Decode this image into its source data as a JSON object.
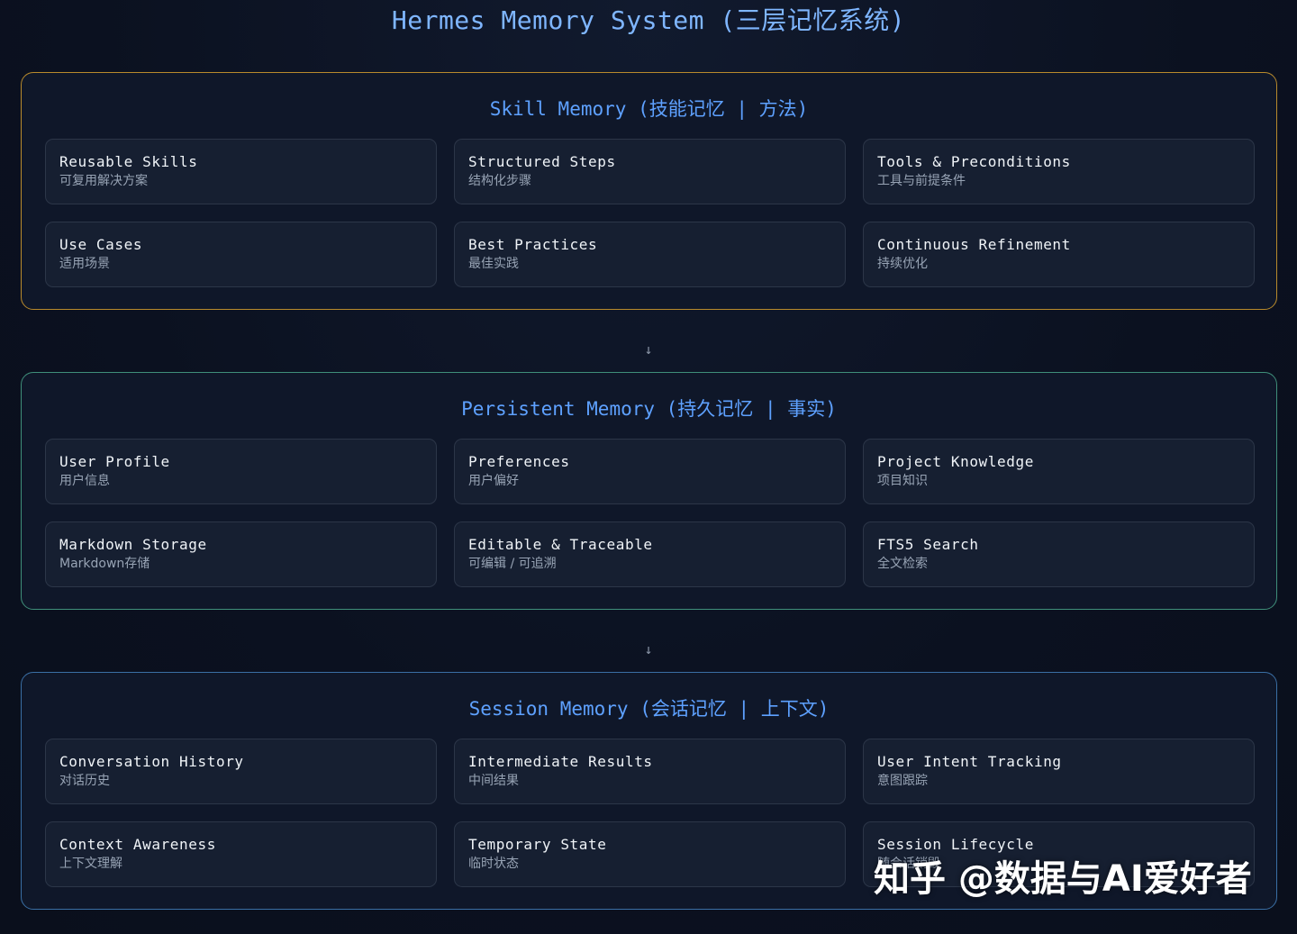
{
  "title": "Hermes Memory System (三层记忆系统)",
  "arrow": "↓",
  "watermark": "知乎 @数据与AI爱好者",
  "colors": {
    "title": "#7fb6ff",
    "skill_border": "#b88a2c",
    "persistent_border": "#3f8f7a",
    "session_border": "#3a6fa5",
    "panel_title": "#5ea1ff"
  },
  "layers": [
    {
      "title": "Skill Memory (技能记忆 | 方法)",
      "cards": [
        {
          "title": "Reusable Skills",
          "sub": "可复用解决方案"
        },
        {
          "title": "Structured Steps",
          "sub": "结构化步骤"
        },
        {
          "title": "Tools & Preconditions",
          "sub": "工具与前提条件"
        },
        {
          "title": "Use Cases",
          "sub": "适用场景"
        },
        {
          "title": "Best Practices",
          "sub": "最佳实践"
        },
        {
          "title": "Continuous Refinement",
          "sub": "持续优化"
        }
      ]
    },
    {
      "title": "Persistent Memory (持久记忆 | 事实)",
      "cards": [
        {
          "title": "User Profile",
          "sub": "用户信息"
        },
        {
          "title": "Preferences",
          "sub": "用户偏好"
        },
        {
          "title": "Project Knowledge",
          "sub": "项目知识"
        },
        {
          "title": "Markdown Storage",
          "sub": "Markdown存储"
        },
        {
          "title": "Editable & Traceable",
          "sub": "可编辑 / 可追溯"
        },
        {
          "title": "FTS5 Search",
          "sub": "全文检索"
        }
      ]
    },
    {
      "title": "Session Memory (会话记忆 | 上下文)",
      "cards": [
        {
          "title": "Conversation History",
          "sub": "对话历史"
        },
        {
          "title": "Intermediate Results",
          "sub": "中间结果"
        },
        {
          "title": "User Intent Tracking",
          "sub": "意图跟踪"
        },
        {
          "title": "Context Awareness",
          "sub": "上下文理解"
        },
        {
          "title": "Temporary State",
          "sub": "临时状态"
        },
        {
          "title": "Session Lifecycle",
          "sub": "随会话销毁"
        }
      ]
    }
  ]
}
